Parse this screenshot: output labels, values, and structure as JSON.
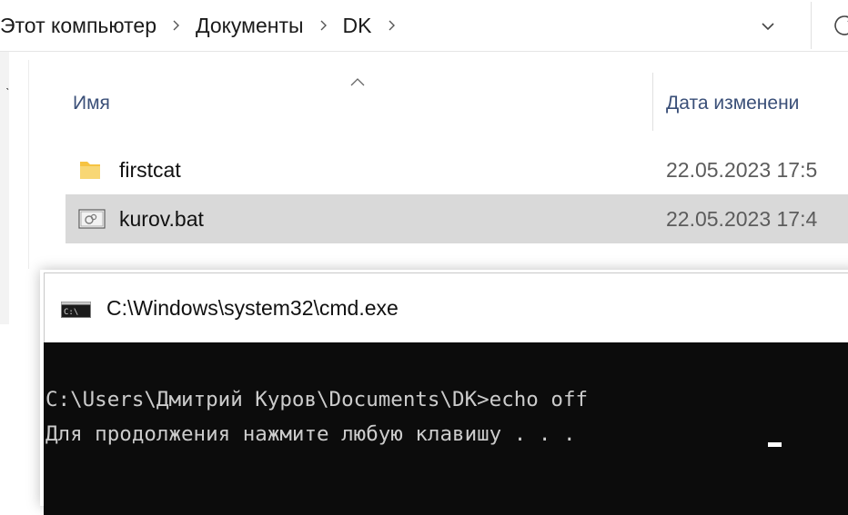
{
  "breadcrumb": {
    "items": [
      "Этот компьютер",
      "Документы",
      "DK"
    ]
  },
  "icons": {
    "chevron": "chevron-right-icon",
    "dropdown": "chevron-down-icon",
    "refresh": "refresh-icon",
    "sort": "sort-up-icon",
    "folder": "folder-icon",
    "batch": "batch-file-icon",
    "cmd": "cmd-icon"
  },
  "columns": {
    "name": "Имя",
    "date": "Дата изменени"
  },
  "files": [
    {
      "name": "firstcat",
      "date": "22.05.2023 17:5",
      "type": "folder"
    },
    {
      "name": "kurov.bat",
      "date": "22.05.2023 17:4",
      "type": "batch",
      "selected": true
    }
  ],
  "cmd": {
    "title": "C:\\Windows\\system32\\cmd.exe",
    "lines": [
      "C:\\Users\\Дмитрий Куров\\Documents\\DK>echo off",
      "Для продолжения нажмите любую клавишу . . ."
    ]
  },
  "colors": {
    "selection": "#d9d9d9",
    "header_text": "#3a4f78",
    "console_bg": "#0c0c0c",
    "console_text": "#cccccc",
    "folder": "#f6c342"
  }
}
